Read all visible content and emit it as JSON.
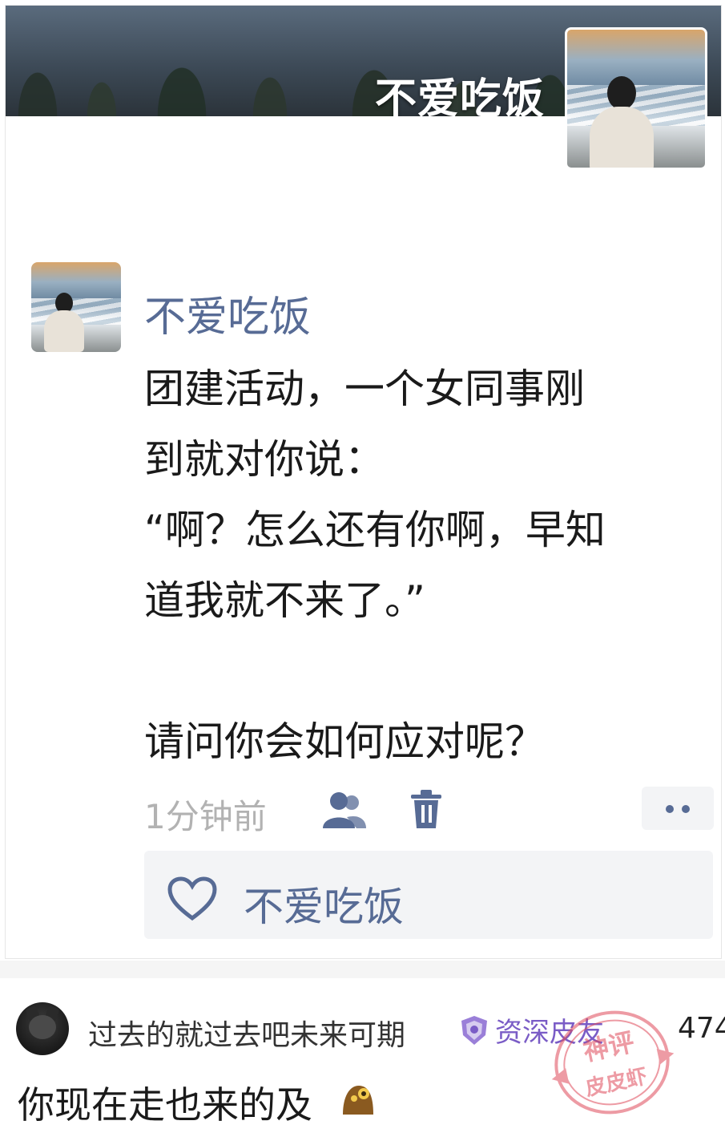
{
  "cover": {
    "name": "不爱吃饭"
  },
  "post": {
    "author": "不爱吃饭",
    "text": "团建活动，一个女同事刚\n到就对你说：\n“啊？怎么还有你啊，早知\n道我就不来了。”\n\n请问你会如何应对呢？",
    "time": "1分钟前",
    "icons": [
      "friends-icon",
      "trash-icon",
      "more-icon"
    ],
    "likes": {
      "icon": "heart-icon",
      "names": "不爱吃饭"
    }
  },
  "comment": {
    "username": "过去的就过去吧未来可期",
    "badge": {
      "icon": "shield-badge-icon",
      "label": "资深皮友"
    },
    "count": "474",
    "text": "你现在走也来的及",
    "emoji": "doge-emoji"
  },
  "watermark": {
    "line1": "神评",
    "line2": "皮皮虾"
  },
  "colors": {
    "link": "#576b95",
    "time": "#b2b2b2",
    "badge": "#7a5cc6",
    "watermark": "#e04a5a",
    "like_bg": "#f3f4f6"
  }
}
